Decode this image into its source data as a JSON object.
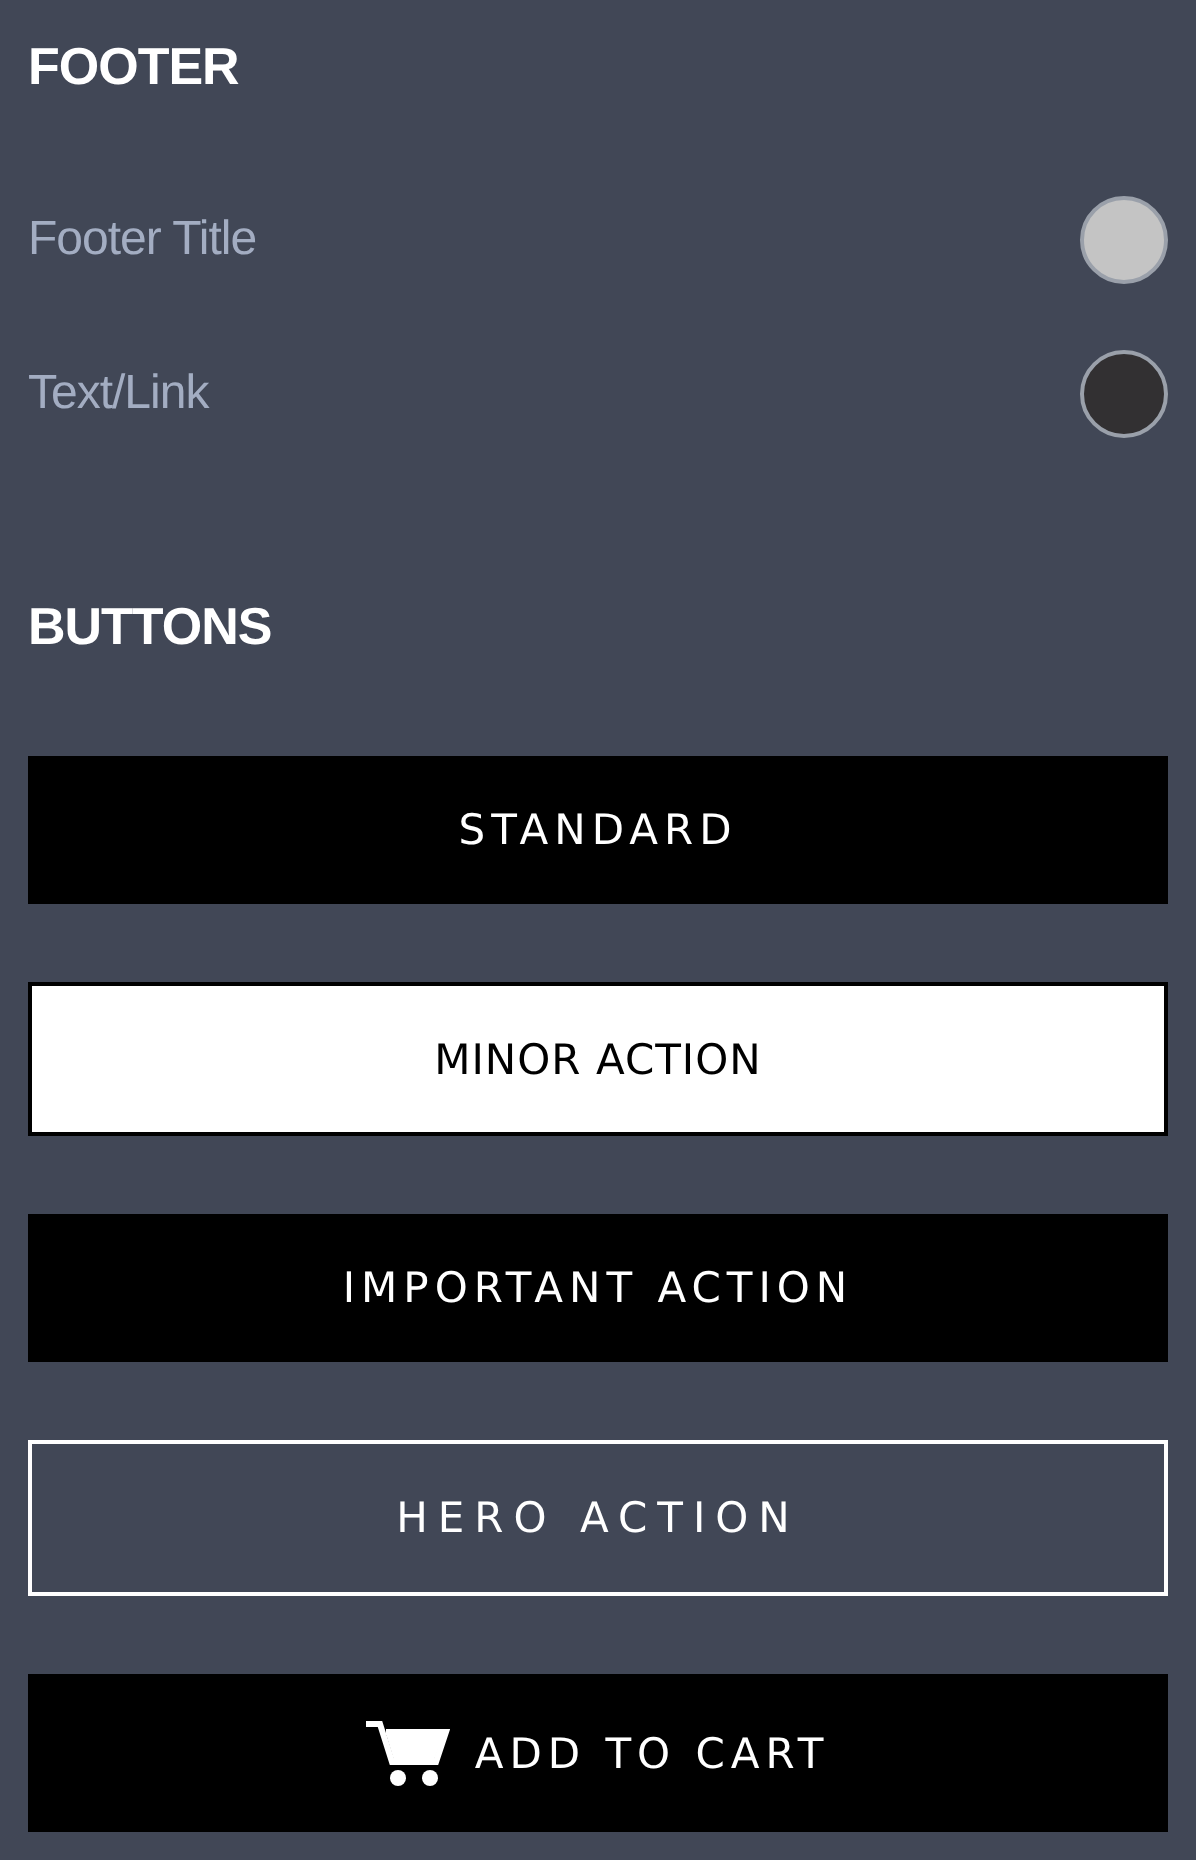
{
  "sections": [
    {
      "title": "FOOTER",
      "swatches": [
        {
          "label": "Footer Title",
          "color": "#c4c4c4"
        },
        {
          "label": "Text/Link",
          "color": "#323032"
        }
      ]
    },
    {
      "title": "BUTTONS",
      "buttons": [
        {
          "label": "STANDARD",
          "kind": "solid"
        },
        {
          "label": "MINOR ACTION",
          "kind": "light"
        },
        {
          "label": "IMPORTANT ACTION",
          "kind": "solid"
        },
        {
          "label": "HERO ACTION",
          "kind": "outline"
        },
        {
          "label": "ADD TO CART",
          "kind": "cart"
        }
      ]
    }
  ]
}
